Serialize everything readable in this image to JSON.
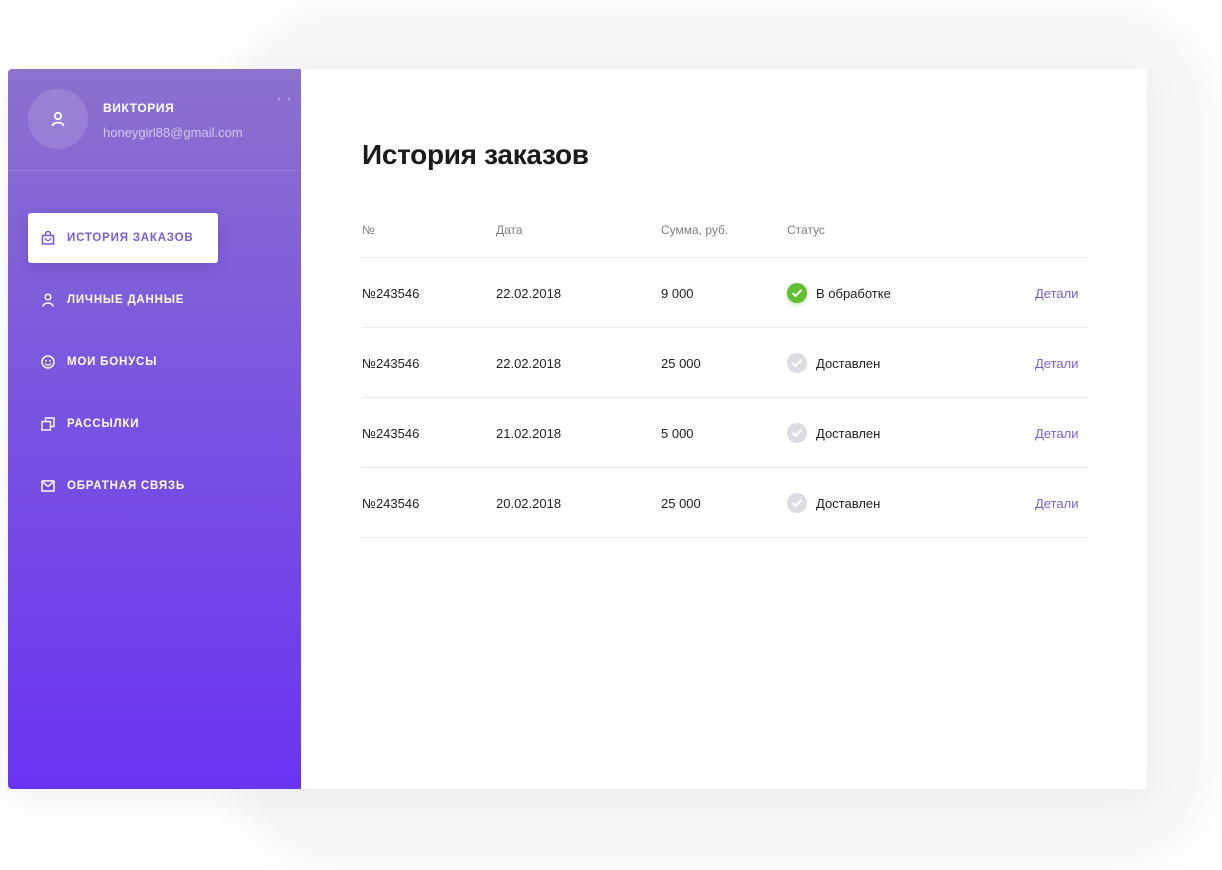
{
  "user": {
    "name": "Виктория",
    "email": "honeygirl88@gmail.com"
  },
  "nav": {
    "items": [
      {
        "label": "История заказов",
        "icon": "shopping-bag-icon",
        "active": true
      },
      {
        "label": "Личные данные",
        "icon": "user-icon",
        "active": false
      },
      {
        "label": "Мои бонусы",
        "icon": "smiley-icon",
        "active": false
      },
      {
        "label": "Рассылки",
        "icon": "stacked-squares-icon",
        "active": false
      },
      {
        "label": "Обратная связь",
        "icon": "envelope-icon",
        "active": false
      }
    ]
  },
  "page": {
    "title": "История заказов"
  },
  "table": {
    "headers": {
      "num": "№",
      "date": "Дата",
      "sum": "Сумма, руб.",
      "status": "Статус"
    },
    "rows": [
      {
        "num": "№243546",
        "date": "22.02.2018",
        "sum": "9 000",
        "status": "В обработке",
        "status_icon": "check-circle-green-icon",
        "details": "Детали"
      },
      {
        "num": "№243546",
        "date": "22.02.2018",
        "sum": "25 000",
        "status": "Доставлен",
        "status_icon": "check-circle-grey-icon",
        "details": "Детали"
      },
      {
        "num": "№243546",
        "date": "21.02.2018",
        "sum": "5 000",
        "status": "Доставлен",
        "status_icon": "check-circle-grey-icon",
        "details": "Детали"
      },
      {
        "num": "№243546",
        "date": "20.02.2018",
        "sum": "25 000",
        "status": "Доставлен",
        "status_icon": "check-circle-grey-icon",
        "details": "Детали"
      }
    ]
  },
  "colors": {
    "sidebar_top": "#8b72cd",
    "sidebar_bottom": "#6a34f2",
    "accent": "#7b5bd6",
    "status_processing": "#5ec030",
    "status_delivered": "#dcdce4",
    "link": "#7a62c9"
  }
}
